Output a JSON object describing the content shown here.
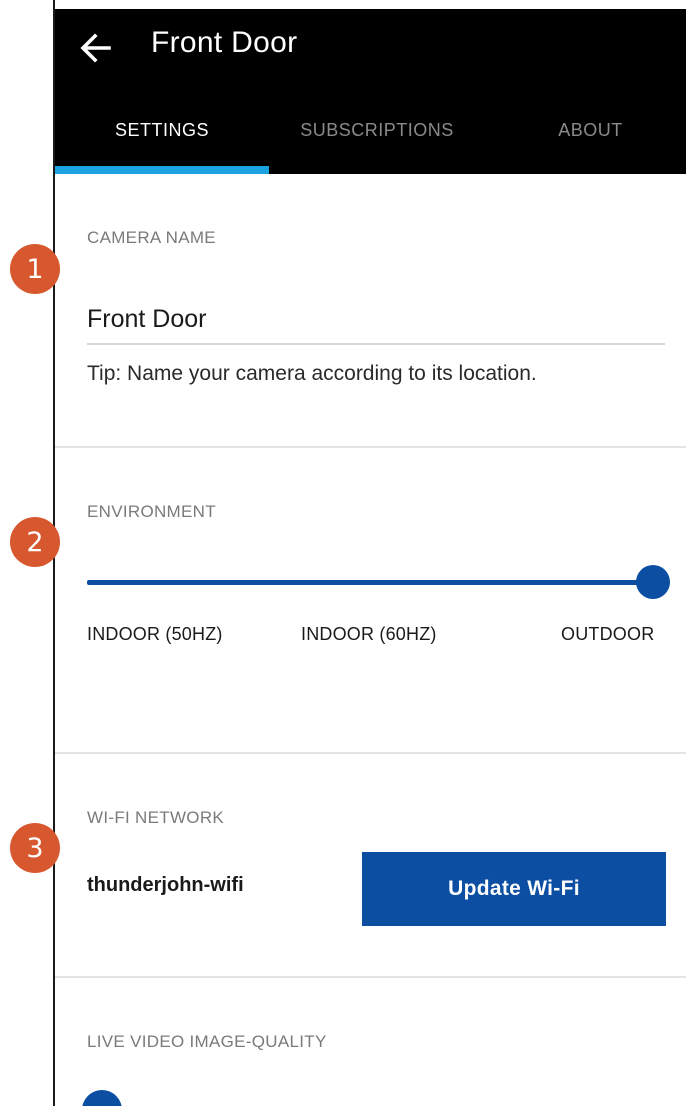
{
  "header": {
    "title": "Front Door",
    "back_icon": "arrow-left-icon"
  },
  "tabs": [
    {
      "label": "SETTINGS",
      "active": true
    },
    {
      "label": "SUBSCRIPTIONS",
      "active": false
    },
    {
      "label": "ABOUT",
      "active": false
    }
  ],
  "badges": [
    "1",
    "2",
    "3"
  ],
  "camera_name": {
    "label": "CAMERA NAME",
    "value": "Front Door",
    "tip": "Tip: Name your camera according to its location."
  },
  "environment": {
    "label": "ENVIRONMENT",
    "options": [
      "INDOOR (50HZ)",
      "INDOOR (60HZ)",
      "OUTDOOR"
    ],
    "selected": "OUTDOOR"
  },
  "wifi": {
    "label": "WI-FI NETWORK",
    "network": "thunderjohn-wifi",
    "button_label": "Update Wi-Fi"
  },
  "video_quality": {
    "label": "LIVE VIDEO IMAGE-QUALITY"
  },
  "colors": {
    "accent_blue": "#0b4ea2",
    "tab_indicator": "#1aa3e0",
    "badge": "#d7582e",
    "appbar_bg": "#000000"
  }
}
